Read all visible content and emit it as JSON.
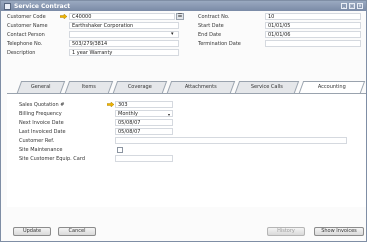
{
  "window": {
    "title": "Service Contract",
    "controls": [
      "_",
      "□",
      "×"
    ]
  },
  "header": {
    "customer_code": {
      "label": "Customer Code",
      "value": "C40000"
    },
    "customer_name": {
      "label": "Customer Name",
      "value": "Earthshaker Corporation"
    },
    "contact_person": {
      "label": "Contact Person",
      "value": ""
    },
    "telephone": {
      "label": "Telephone No.",
      "value": "503/279/3814"
    },
    "description": {
      "label": "Description",
      "value": "1 year Warranty"
    },
    "contract_no": {
      "label": "Contract No.",
      "value": "10"
    },
    "start_date": {
      "label": "Start Date",
      "value": "01/01/05"
    },
    "end_date": {
      "label": "End Date",
      "value": "01/01/06"
    },
    "termination_date": {
      "label": "Termination Date",
      "value": ""
    }
  },
  "tabs": [
    "General",
    "Items",
    "Coverage",
    "Attachments",
    "Service Calls",
    "Accounting"
  ],
  "active_tab": "Accounting",
  "accounting": {
    "sales_quotation": {
      "label": "Sales Quotation #",
      "value": "303"
    },
    "billing_frequency": {
      "label": "Billing Frequency",
      "value": "Monthly"
    },
    "next_invoice_date": {
      "label": "Next Invoice Date",
      "value": "05/08/07"
    },
    "last_invoiced_date": {
      "label": "Last Invoiced Date",
      "value": "05/08/07"
    },
    "customer_ref": {
      "label": "Customer Ref.",
      "value": ""
    },
    "site_maintenance": {
      "label": "Site Maintenance",
      "checked": false
    },
    "site_customer_equip_card": {
      "label": "Site Customer Equip. Card",
      "value": ""
    }
  },
  "buttons": {
    "update": "Update",
    "cancel": "Cancel",
    "history": "History",
    "show_invoices": "Show Invoices"
  },
  "colors": {
    "titlebar": "#7a8aa6",
    "arrow": "#f0b400"
  }
}
